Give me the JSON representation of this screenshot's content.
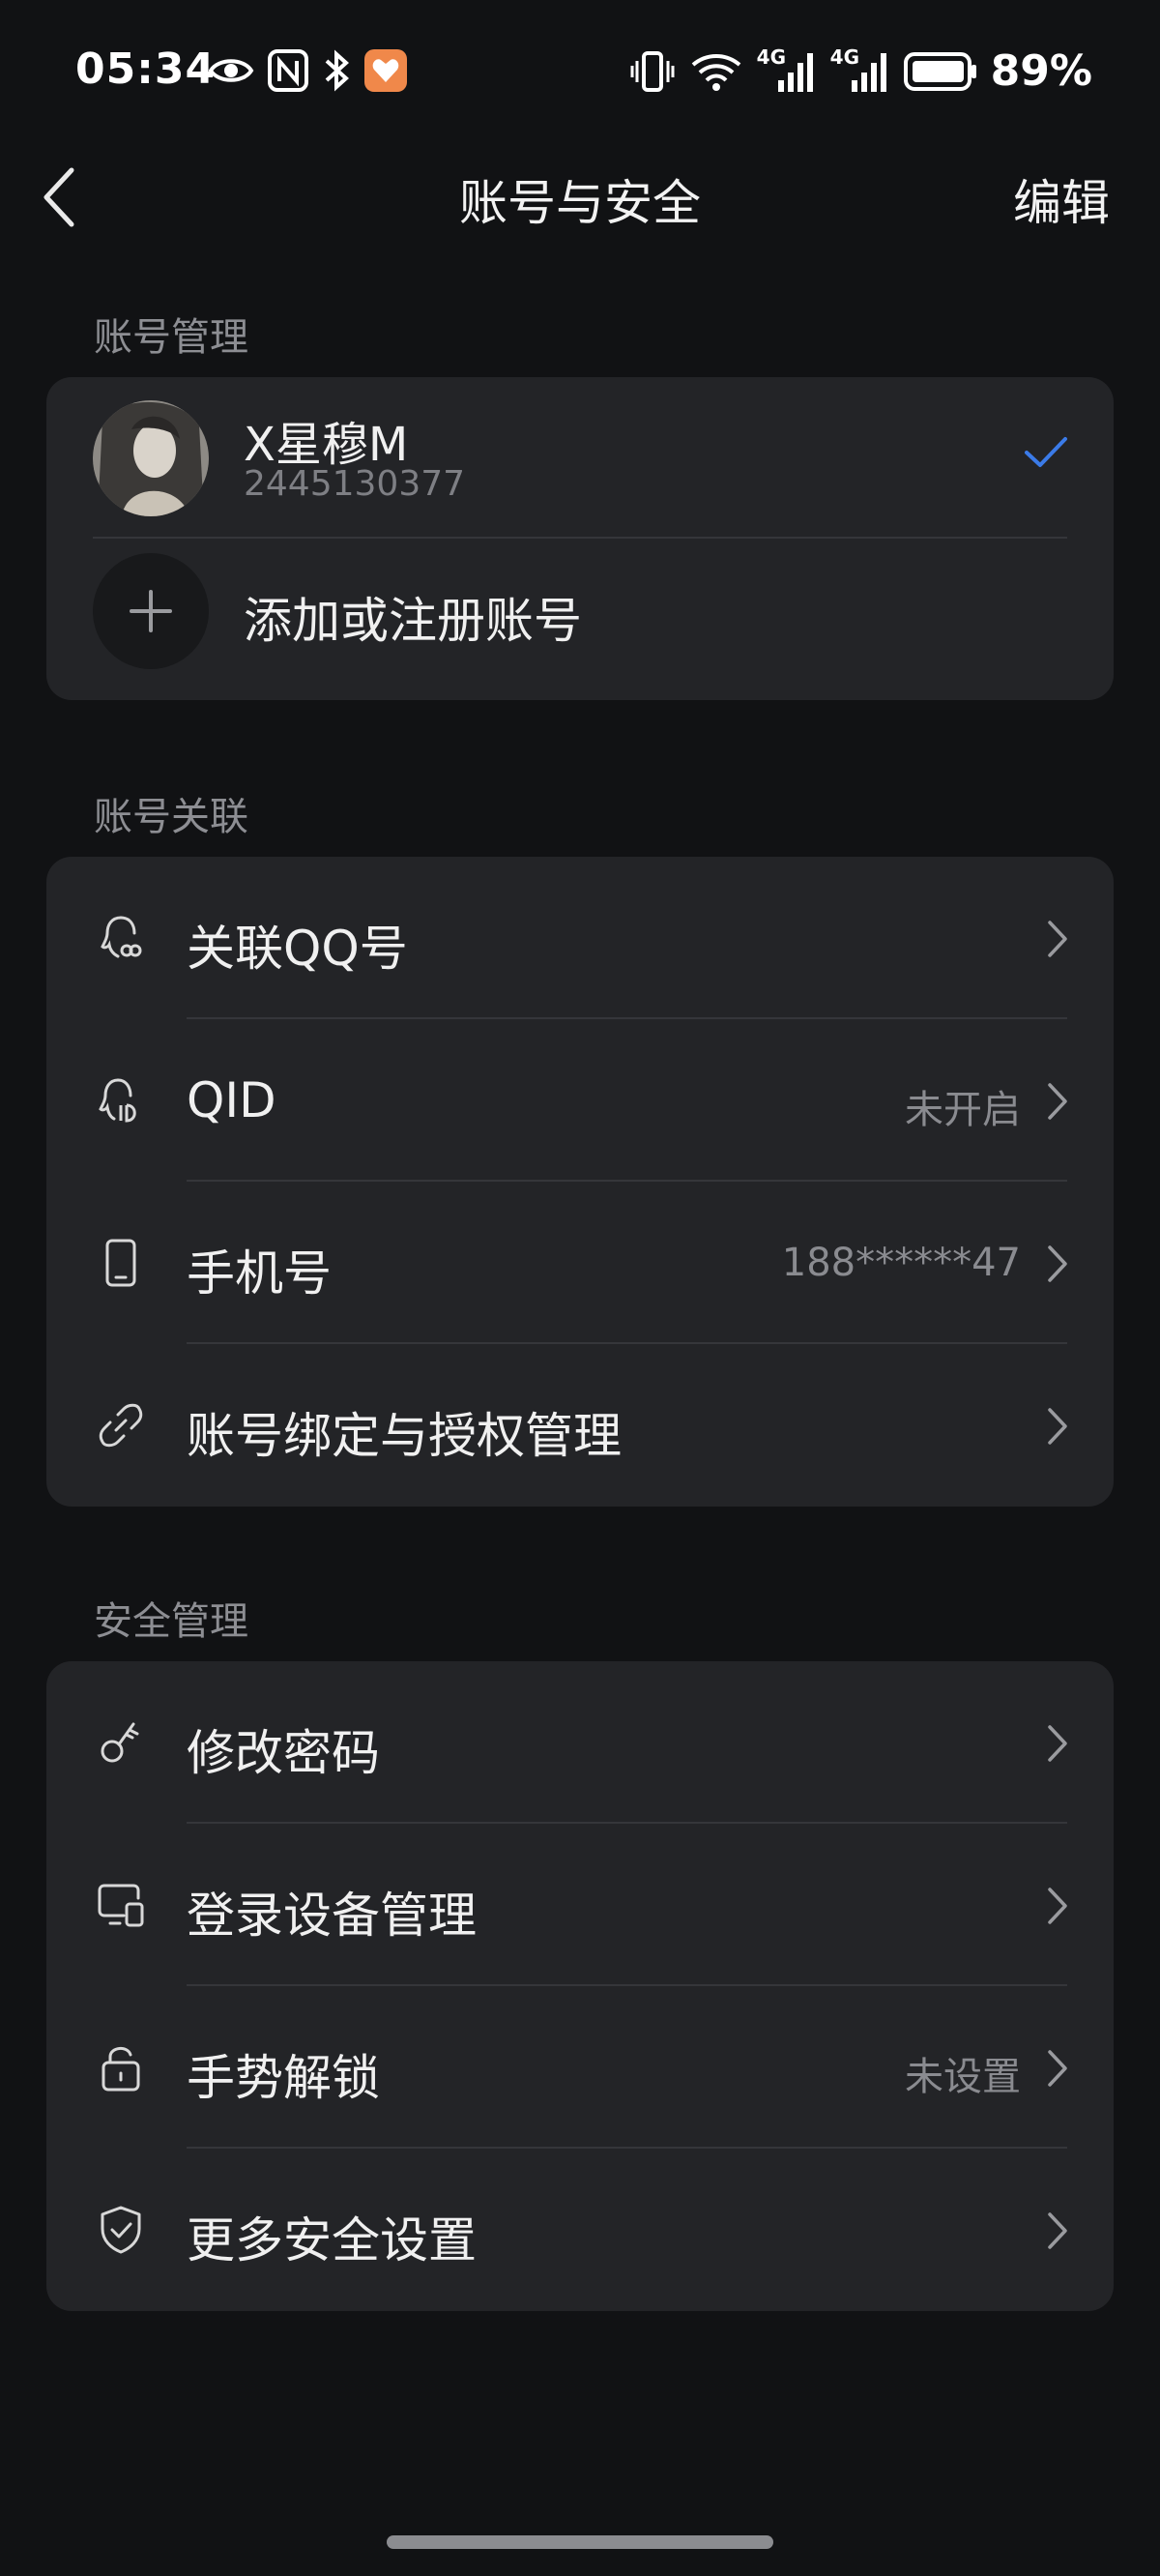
{
  "status_bar": {
    "time": "05:34",
    "battery": "89%",
    "network_1": "4G",
    "network_2": "4G"
  },
  "nav": {
    "title": "账号与安全",
    "edit_label": "编辑"
  },
  "sections": {
    "account_management": "账号管理",
    "account_links": "账号关联",
    "security_management": "安全管理"
  },
  "account": {
    "name": "X星穆M",
    "id": "2445130377",
    "add_label": "添加或注册账号"
  },
  "link_items": [
    {
      "label": "关联QQ号",
      "value": "",
      "icon": "qq-link-icon"
    },
    {
      "label": "QID",
      "value": "未开启",
      "icon": "qid-icon"
    },
    {
      "label": "手机号",
      "value": "188******47",
      "icon": "phone-icon"
    },
    {
      "label": "账号绑定与授权管理",
      "value": "",
      "icon": "link-chain-icon"
    }
  ],
  "security_items": [
    {
      "label": "修改密码",
      "value": "",
      "icon": "key-icon"
    },
    {
      "label": "登录设备管理",
      "value": "",
      "icon": "devices-icon"
    },
    {
      "label": "手势解锁",
      "value": "未设置",
      "icon": "lock-icon"
    },
    {
      "label": "更多安全设置",
      "value": "",
      "icon": "shield-check-icon"
    }
  ],
  "colors": {
    "background": "#111214",
    "card": "#232427",
    "accent_check": "#3b7be8",
    "secondary_text": "#8a8b90"
  }
}
